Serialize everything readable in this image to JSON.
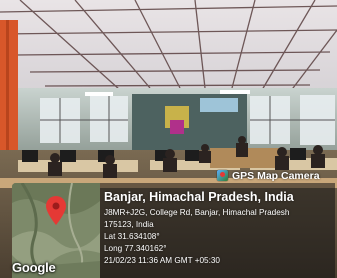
{
  "badge": {
    "label": "GPS Map Camera",
    "icon": "gps-map-camera-icon"
  },
  "map": {
    "provider_mark": "Google",
    "pin_color": "#e53935"
  },
  "location": {
    "title": "Banjar, Himachal Pradesh, India",
    "address_line1": "J8MR+J2G, College Rd, Banjar, Himachal Pradesh",
    "address_line2": "175123, India",
    "latitude": "Lat 31.634108°",
    "longitude": "Long 77.340162°",
    "timestamp": "21/02/23 11:36 AM GMT +05:30"
  },
  "colors": {
    "overlay": "#141414",
    "text": "#ffffff",
    "ceiling_grid": "#3a2a2a",
    "curtain": "#d8572a"
  }
}
